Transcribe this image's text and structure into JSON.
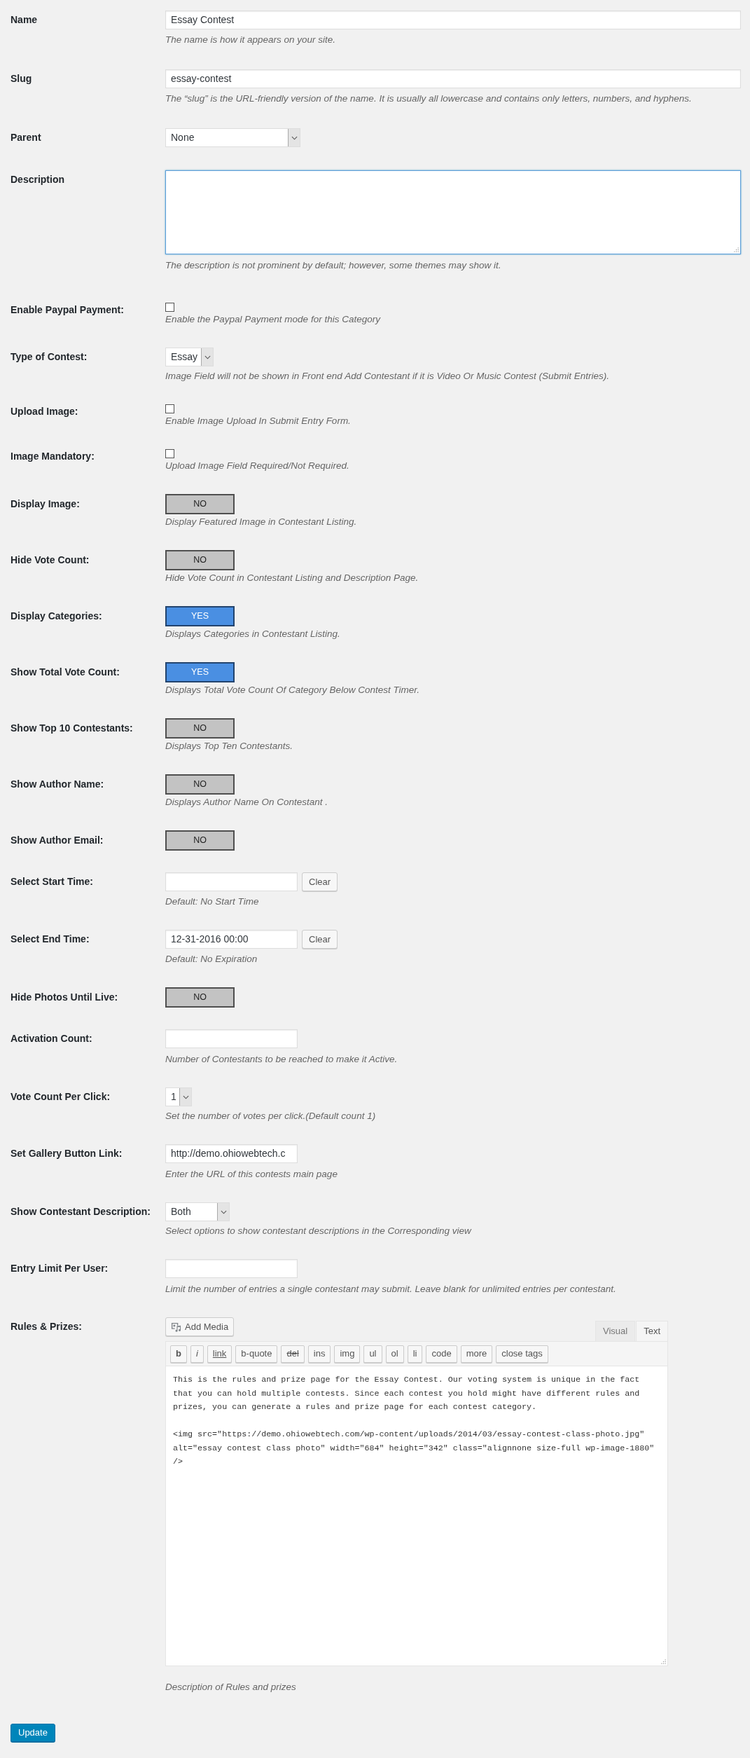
{
  "term_fields": [
    {
      "kind": "wide_text",
      "label": "Name",
      "value": "Essay Contest",
      "hint": "The name is how it appears on your site."
    },
    {
      "kind": "wide_text",
      "label": "Slug",
      "value": "essay-contest",
      "hint": "The “slug” is the URL-friendly version of the name. It is usually all lowercase and contains only letters, numbers, and hyphens."
    },
    {
      "kind": "select",
      "label": "Parent",
      "value": "None"
    },
    {
      "kind": "textarea",
      "label": "Description",
      "focused": true,
      "hint": "The description is not prominent by default; however, some themes may show it."
    }
  ],
  "contest_fields": [
    {
      "kind": "checkbox",
      "label": "Enable Paypal Payment:",
      "checked": false,
      "hint": "Enable the Paypal Payment mode for this Category"
    },
    {
      "kind": "select",
      "label": "Type of Contest:",
      "value": "Essay",
      "hint": "Image Field will not be shown in Front end Add Contestant if it is Video Or Music Contest (Submit Entries)."
    },
    {
      "kind": "checkbox",
      "label": "Upload Image:",
      "checked": false,
      "hint": "Enable Image Upload In Submit Entry Form."
    },
    {
      "kind": "checkbox",
      "label": "Image Mandatory:",
      "checked": false,
      "hint": "Upload Image Field Required/Not Required."
    },
    {
      "kind": "toggle",
      "label": "Display Image:",
      "on": false,
      "text": "NO",
      "hint": "Display Featured Image in Contestant Listing."
    },
    {
      "kind": "toggle",
      "label": "Hide Vote Count:",
      "on": false,
      "text": "NO",
      "hint": "Hide Vote Count in Contestant Listing and Description Page."
    },
    {
      "kind": "toggle",
      "label": "Display Categories:",
      "on": true,
      "text": "YES",
      "hint": "Displays Categories in Contestant Listing."
    },
    {
      "kind": "toggle",
      "label": "Show Total Vote Count:",
      "on": true,
      "text": "YES",
      "hint": "Displays Total Vote Count Of Category Below Contest Timer."
    },
    {
      "kind": "toggle",
      "label": "Show Top 10 Contestants:",
      "on": false,
      "text": "NO",
      "hint": "Displays Top Ten Contestants."
    },
    {
      "kind": "toggle",
      "label": "Show Author Name:",
      "on": false,
      "text": "NO",
      "hint": "Displays Author Name On Contestant ."
    },
    {
      "kind": "toggle",
      "label": "Show Author Email:",
      "on": false,
      "text": "NO"
    },
    {
      "kind": "date",
      "label": "Select Start Time:",
      "button": "Clear",
      "hint": "Default: No Start Time"
    },
    {
      "kind": "date",
      "label": "Select End Time:",
      "value": "12-31-2016 00:00",
      "button": "Clear",
      "hint": "Default: No Expiration"
    },
    {
      "kind": "toggle",
      "label": "Hide Photos Until Live:",
      "on": false,
      "text": "NO"
    },
    {
      "kind": "text",
      "label": "Activation Count:",
      "hint": "Number of Contestants to be reached to make it Active."
    },
    {
      "kind": "select",
      "label": "Vote Count Per Click:",
      "value": "1",
      "hint": "Set the number of votes per click.(Default count 1)"
    },
    {
      "kind": "text",
      "label": "Set Gallery Button Link:",
      "value": "http://demo.ohiowebtech.c",
      "hint": "Enter the URL of this contests main page"
    },
    {
      "kind": "select",
      "label": "Show Contestant Description:",
      "value": "Both",
      "hint": "Select options to show contestant descriptions in the Corresponding view"
    },
    {
      "kind": "text",
      "label": "Entry Limit Per User:",
      "hint": "Limit the number of entries a single contestant may submit. Leave blank for unlimited entries per contestant."
    },
    {
      "kind": "editor",
      "label": "Rules & Prizes:",
      "media_button": "Add Media",
      "tabs": [
        {
          "label": "Visual",
          "selected": false
        },
        {
          "label": "Text",
          "selected": true
        }
      ],
      "toolbar": [
        {
          "label": "b",
          "kind": "bold"
        },
        {
          "label": "i",
          "kind": "italic"
        },
        {
          "label": "link",
          "kind": "link"
        },
        {
          "label": "b-quote",
          "kind": "plain"
        },
        {
          "label": "del",
          "kind": "strike"
        },
        {
          "label": "ins",
          "kind": "plain"
        },
        {
          "label": "img",
          "kind": "plain"
        },
        {
          "label": "ul",
          "kind": "plain"
        },
        {
          "label": "ol",
          "kind": "plain"
        },
        {
          "label": "li",
          "kind": "plain"
        },
        {
          "label": "code",
          "kind": "plain"
        },
        {
          "label": "more",
          "kind": "plain"
        },
        {
          "label": "close tags",
          "kind": "plain"
        }
      ],
      "value": "This is the rules and prize page for the Essay Contest. Our voting system is unique in the fact that you can hold multiple contests. Since each contest you hold might have different rules and prizes, you can generate a rules and prize page for each contest category.\n\n<img src=\"https://demo.ohiowebtech.com/wp-content/uploads/2014/03/essay-contest-class-photo.jpg\" alt=\"essay contest class photo\" width=\"684\" height=\"342\" class=\"alignnone size-full wp-image-1880\" />",
      "hint": "Description of Rules and prizes"
    }
  ],
  "submit_button": "Update"
}
